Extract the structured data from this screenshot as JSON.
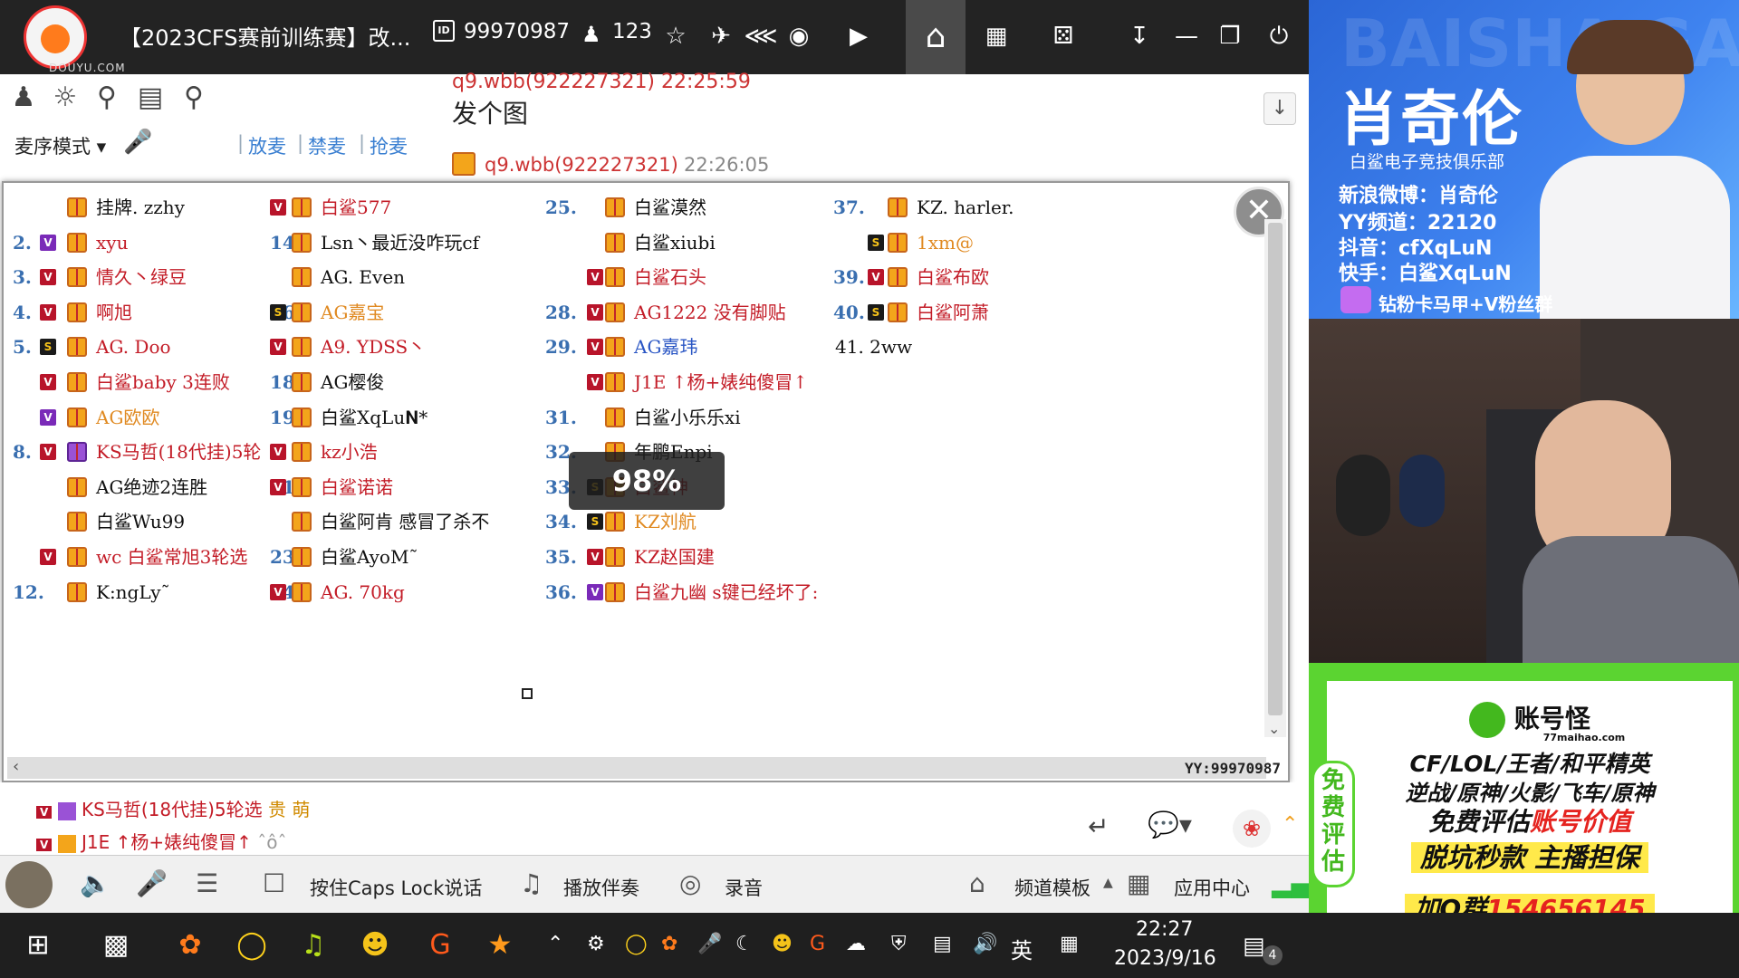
{
  "titlebar": {
    "logo_text": "DOUYU.COM",
    "room_title": "【2023CFS赛前训练赛】改...",
    "room_id_badge": "ID",
    "room_id": "99970987",
    "online_count": "123"
  },
  "toolbar": {
    "mic_mode": "麦序模式",
    "mic_links": [
      "放麦",
      "禁麦",
      "抢麦"
    ]
  },
  "chat": {
    "cut_line": "q9.wbb(922227321)  22:25:59",
    "message": "发个图",
    "sender": "q9.wbb(922227321)",
    "time": "22:26:05"
  },
  "list": {
    "col1": [
      {
        "num": "",
        "v": "",
        "g": "gold",
        "name": "挂牌. zzhy",
        "color": "black"
      },
      {
        "num": "2.",
        "v": "P",
        "g": "gold",
        "name": "xyu",
        "color": "red"
      },
      {
        "num": "3.",
        "v": "V",
        "g": "gold",
        "name": "情久丶绿豆",
        "color": "red"
      },
      {
        "num": "4.",
        "v": "V",
        "g": "gold",
        "name": "啊旭",
        "color": "red"
      },
      {
        "num": "5.",
        "v": "S",
        "g": "gold",
        "name": "AG. Doo",
        "color": "red"
      },
      {
        "num": "",
        "v": "V",
        "g": "gold",
        "name": "白鲨baby 3连败",
        "color": "red"
      },
      {
        "num": "",
        "v": "P",
        "g": "gold",
        "name": "AG欧欧",
        "color": "orange"
      },
      {
        "num": "8.",
        "v": "V",
        "g": "purple",
        "name": "KS马哲(18代挂)5轮",
        "color": "red"
      },
      {
        "num": "",
        "v": "",
        "g": "gold",
        "name": "AG绝迹2连胜",
        "color": "black"
      },
      {
        "num": "",
        "v": "",
        "g": "gold",
        "name": "白鲨Wu99",
        "color": "black"
      },
      {
        "num": "",
        "v": "V",
        "g": "gold",
        "name": "wc 白鲨常旭3轮选",
        "color": "red"
      },
      {
        "num": "12.",
        "v": "",
        "g": "gold",
        "name": "K:ngLy˜",
        "color": "black"
      }
    ],
    "col2": [
      {
        "num": "",
        "v": "V",
        "g": "gold",
        "name": "白鲨577",
        "color": "red"
      },
      {
        "num": "14.",
        "v": "",
        "g": "gold",
        "name": "Lsn丶最近没咋玩cf",
        "color": "black"
      },
      {
        "num": "",
        "v": "",
        "g": "gold",
        "name": "AG. Even",
        "color": "black"
      },
      {
        "num": "16.",
        "v": "S",
        "g": "gold",
        "name": "AG嘉宝",
        "color": "orange"
      },
      {
        "num": "",
        "v": "V",
        "g": "gold",
        "name": "A9. YDSS丶",
        "color": "red"
      },
      {
        "num": "18.",
        "v": "",
        "g": "gold",
        "name": "AG樱俊",
        "color": "black"
      },
      {
        "num": "19.",
        "v": "",
        "g": "gold",
        "name": "白鲨XqLu𝐍*",
        "color": "black"
      },
      {
        "num": "",
        "v": "V",
        "g": "gold",
        "name": "kz小浩",
        "color": "red"
      },
      {
        "num": "21.",
        "v": "V",
        "g": "gold",
        "name": "白鲨诺诺",
        "color": "red"
      },
      {
        "num": "",
        "v": "",
        "g": "gold",
        "name": "白鲨阿肯 感冒了杀不",
        "color": "black"
      },
      {
        "num": "23.",
        "v": "",
        "g": "gold",
        "name": "白鲨AyoM˜",
        "color": "black"
      },
      {
        "num": "24.",
        "v": "V",
        "g": "gold",
        "name": "AG. 70kg",
        "color": "red"
      }
    ],
    "col3": [
      {
        "num": "25.",
        "v": "",
        "g": "gold",
        "name": "白鲨漠然",
        "color": "black"
      },
      {
        "num": "",
        "v": "",
        "g": "gold",
        "name": "白鲨xiubi",
        "color": "black"
      },
      {
        "num": "",
        "v": "V",
        "g": "gold",
        "name": "白鲨石头",
        "color": "red"
      },
      {
        "num": "28.",
        "v": "V",
        "g": "gold",
        "name": "AG1222 没有脚贴",
        "color": "red"
      },
      {
        "num": "29.",
        "v": "V",
        "g": "gold",
        "name": "AG嘉玮",
        "color": "blue"
      },
      {
        "num": "",
        "v": "V",
        "g": "gold",
        "name": "J1E ↑杨+婊纯傻冒↑",
        "color": "red"
      },
      {
        "num": "31.",
        "v": "",
        "g": "gold",
        "name": "白鲨小乐乐xi",
        "color": "black"
      },
      {
        "num": "32.",
        "v": "",
        "g": "gold",
        "name": "年鹏Enpi",
        "color": "black"
      },
      {
        "num": "33.",
        "v": "S",
        "g": "gold",
        "name": "白鲨神",
        "color": "red"
      },
      {
        "num": "34.",
        "v": "S",
        "g": "gold",
        "name": "KZ刘航",
        "color": "orange"
      },
      {
        "num": "35.",
        "v": "V",
        "g": "gold",
        "name": "KZ赵国建",
        "color": "red"
      },
      {
        "num": "36.",
        "v": "P",
        "g": "gold",
        "name": "白鲨九幽 s键已经坏了:",
        "color": "red"
      }
    ],
    "col4": [
      {
        "num": "37.",
        "v": "",
        "g": "gold",
        "name": "KZ. harler.",
        "color": "black"
      },
      {
        "num": "",
        "v": "S",
        "g": "gold",
        "name": "1xm@",
        "color": "orange"
      },
      {
        "num": "39.",
        "v": "V",
        "g": "gold",
        "name": "白鲨布欧",
        "color": "red"
      },
      {
        "num": "40.",
        "v": "S",
        "g": "gold",
        "name": "白鲨阿萧",
        "color": "red"
      },
      {
        "num": "",
        "v": "",
        "g": "",
        "name": "41. 2ww",
        "color": "black"
      }
    ],
    "zoom_percent": "98%",
    "watermark": "YY:99970987"
  },
  "below": {
    "rows": [
      {
        "name": "KS马哲(18代挂)5轮选",
        "tags": "贵 萌"
      },
      {
        "name": "J1E ↑杨+婊纯傻冒↑",
        "tags": "ˆôˆ"
      }
    ]
  },
  "statusbar": {
    "caps_lock": "按住Caps Lock说话",
    "accompaniment": "播放伴奏",
    "record": "录音",
    "channel_template": "频道模板",
    "app_center": "应用中心"
  },
  "stream": {
    "name": "肖奇伦",
    "club": "白鲨电子竞技俱乐部",
    "weibo": "新浪微博：肖奇伦",
    "yy": "YY频道：22120",
    "douyin": "抖音：cfXqLuN",
    "kuaishou": "快手：白鲨XqLuN",
    "fans": "钻粉卡马甲+V粉丝群"
  },
  "ad": {
    "brand": "账号怪",
    "domain": "77maihao.com",
    "line1": "CF/LOL/王者/和平精英",
    "line2": "逆战/原神/火影/飞车/原神",
    "line3a": "免费评估",
    "line3b": "账号价值",
    "line4": "脱坑秒款 主播担保",
    "line5a": "加Q群",
    "line5b": "154656145",
    "side": "免费评估"
  },
  "taskbar": {
    "ime": "英",
    "time": "22:27",
    "date": "2023/9/16",
    "notifications": "4"
  }
}
